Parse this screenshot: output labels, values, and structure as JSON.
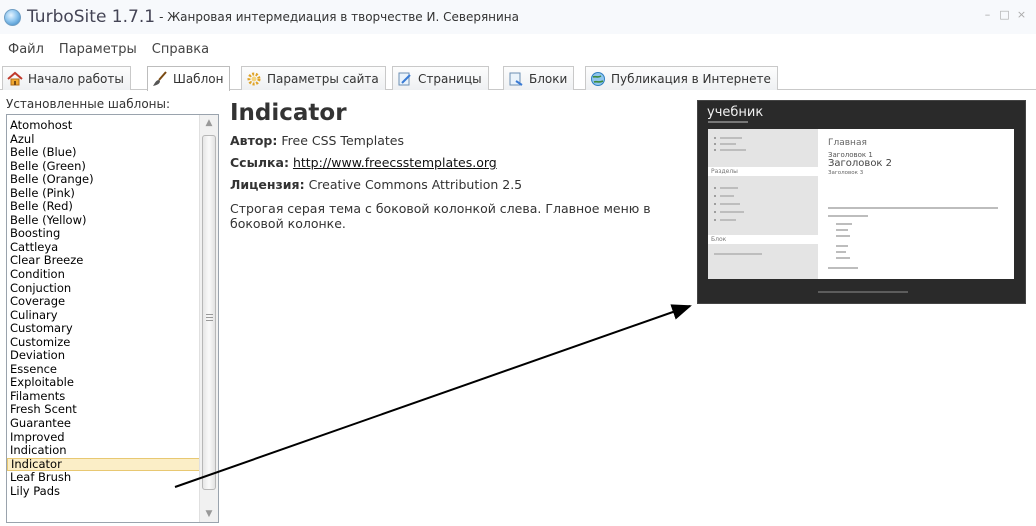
{
  "window": {
    "app_name": "TurboSite 1.7.1",
    "doc_title": "- Жанровая интермедиация в творчестве И. Северянина",
    "controls": [
      "–",
      "□",
      "×"
    ]
  },
  "menu": [
    "Файл",
    "Параметры",
    "Справка"
  ],
  "tabs": [
    {
      "label": "Начало работы",
      "icon": "home-icon",
      "active": false
    },
    {
      "label": "Шаблон",
      "icon": "brush-icon",
      "active": true
    },
    {
      "label": "Параметры сайта",
      "icon": "settings-gear-icon",
      "active": false
    },
    {
      "label": "Страницы",
      "icon": "page-icon",
      "active": false
    },
    {
      "label": "Блоки",
      "icon": "block-icon",
      "active": false
    },
    {
      "label": "Публикация в Интернете",
      "icon": "globe-icon",
      "active": false
    }
  ],
  "templates": {
    "title": "Установленные шаблоны:",
    "items": [
      "Atomohost",
      "Azul",
      "Belle (Blue)",
      "Belle (Green)",
      "Belle (Orange)",
      "Belle (Pink)",
      "Belle (Red)",
      "Belle (Yellow)",
      "Boosting",
      "Cattleya",
      "Clear Breeze",
      "Condition",
      "Conjuction",
      "Coverage",
      "Culinary",
      "Customary",
      "Customize",
      "Deviation",
      "Essence",
      "Exploitable",
      "Filaments",
      "Fresh Scent",
      "Guarantee",
      "Improved",
      "Indication",
      "Indicator",
      "Leaf Brush",
      "Lily Pads"
    ],
    "selected": "Indicator"
  },
  "info": {
    "name": "Indicator",
    "author_label": "Автор:",
    "author": "Free CSS Templates",
    "link_label": "Ссылка:",
    "link": "http://www.freecsstemplates.org",
    "license_label": "Лицензия:",
    "license": "Creative Commons Attribution 2.5",
    "description": "Строгая серая тема с боковой колонкой слева. Главное меню в боковой колонке."
  },
  "preview": {
    "brand": "учебник",
    "sidebar_band1": "Разделы",
    "sidebar_band2": "Блок",
    "h1": "Главная",
    "h2": "Заголовок 1",
    "h3": "Заголовок 2",
    "h4": "Заголовок 3"
  },
  "colors": {
    "selection_bg": "#fbeec7",
    "preview_bg": "#2a2a2a",
    "arrow": "#000000"
  }
}
